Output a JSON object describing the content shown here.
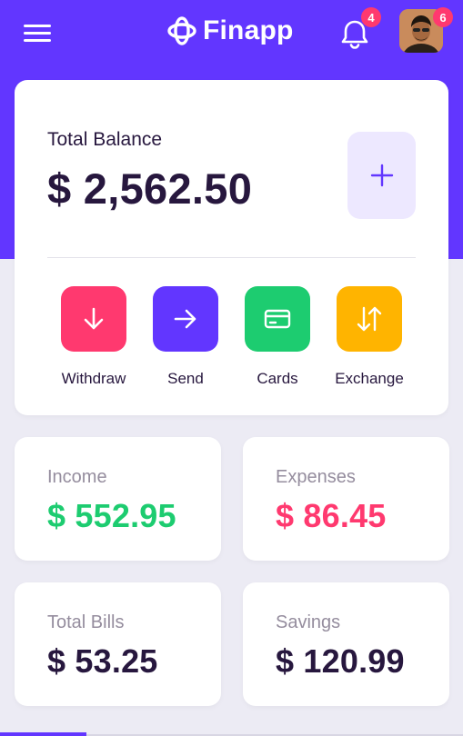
{
  "header": {
    "app_name": "Finapp",
    "notifications_count": "4",
    "profile_badge_count": "6"
  },
  "balance": {
    "label": "Total Balance",
    "value": "$ 2,562.50"
  },
  "actions": [
    {
      "label": "Withdraw",
      "icon": "arrow-down-icon",
      "color": "#FF396F"
    },
    {
      "label": "Send",
      "icon": "arrow-right-icon",
      "color": "#6236FF"
    },
    {
      "label": "Cards",
      "icon": "credit-card-icon",
      "color": "#1DCC70"
    },
    {
      "label": "Exchange",
      "icon": "swap-vertical-icon",
      "color": "#FFB400"
    }
  ],
  "stats": [
    {
      "label": "Income",
      "value": "$ 552.95",
      "color": "#1DCC70"
    },
    {
      "label": "Expenses",
      "value": "$ 86.45",
      "color": "#FF396F"
    },
    {
      "label": "Total Bills",
      "value": "$ 53.25",
      "color": "#27173E"
    },
    {
      "label": "Savings",
      "value": "$ 120.99",
      "color": "#27173E"
    }
  ],
  "colors": {
    "primary": "#6236FF",
    "background": "#ECEBF4",
    "text_dark": "#27173E",
    "text_muted": "#958D9E"
  }
}
